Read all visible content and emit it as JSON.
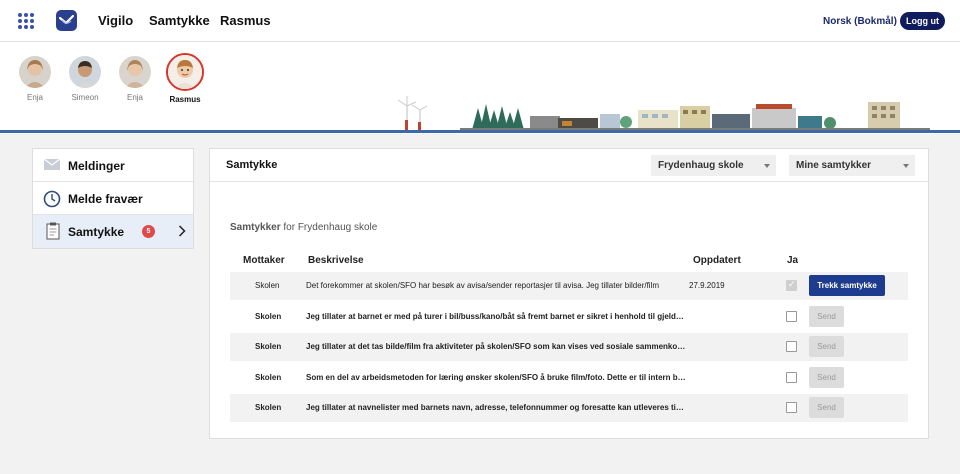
{
  "topbar": {
    "nav": [
      "Vigilo",
      "Samtykke",
      "Rasmus"
    ],
    "language": "Norsk (Bokmål)",
    "logout_label": "Logg ut"
  },
  "children": [
    {
      "name": "Enja",
      "selected": false
    },
    {
      "name": "Simeon",
      "selected": false
    },
    {
      "name": "Enja",
      "selected": false
    },
    {
      "name": "Rasmus",
      "selected": true
    }
  ],
  "sidebar": {
    "items": [
      {
        "label": "Meldinger",
        "icon": "envelope-icon"
      },
      {
        "label": "Melde fravær",
        "icon": "clock-icon"
      },
      {
        "label": "Samtykke",
        "icon": "clipboard-icon",
        "badge": "5",
        "active": true
      }
    ]
  },
  "main": {
    "title": "Samtykke",
    "school_select": "Frydenhaug skole",
    "filter_select": "Mine samtykker",
    "subtitle_bold": "Samtykker",
    "subtitle_rest": " for Frydenhaug skole",
    "columns": {
      "recipient": "Mottaker",
      "description": "Beskrivelse",
      "updated": "Oppdatert",
      "yes": "Ja"
    },
    "rows": [
      {
        "recipient": "Skolen",
        "description": "Det forekommer at skolen/SFO har besøk av avisa/sender reportasjer til avisa. Jeg tillater bilder/film",
        "updated": "27.9.2019",
        "checked": true,
        "action": "Trekk samtykke",
        "bold": false
      },
      {
        "recipient": "Skolen",
        "description": "Jeg tillater at barnet er med på turer i bil/buss/kano/båt så fremt barnet er sikret i henhold til gjeldende regler",
        "updated": "",
        "checked": false,
        "action": "Send",
        "bold": true
      },
      {
        "recipient": "Skolen",
        "description": "Jeg tillater at det tas bilde/film fra aktiviteter på skolen/SFO som kan vises ved sosiale sammenkomster",
        "updated": "",
        "checked": false,
        "action": "Send",
        "bold": true
      },
      {
        "recipient": "Skolen",
        "description": "Som en del av arbeidsmetoden for læring ønsker skolen/SFO å bruke film/foto. Dette er til intern bruk",
        "updated": "",
        "checked": false,
        "action": "Send",
        "bold": true
      },
      {
        "recipient": "Skolen",
        "description": "Jeg tillater at navnelister med barnets navn, adresse, telefonnummer og foresatte kan utleveres til andre foresatte",
        "updated": "",
        "checked": false,
        "action": "Send",
        "bold": true
      }
    ]
  },
  "colors": {
    "brand": "#2b3f8f",
    "button_primary": "#1d3c8f",
    "badge": "#e04a4a",
    "selected_ring": "#d9332b"
  }
}
